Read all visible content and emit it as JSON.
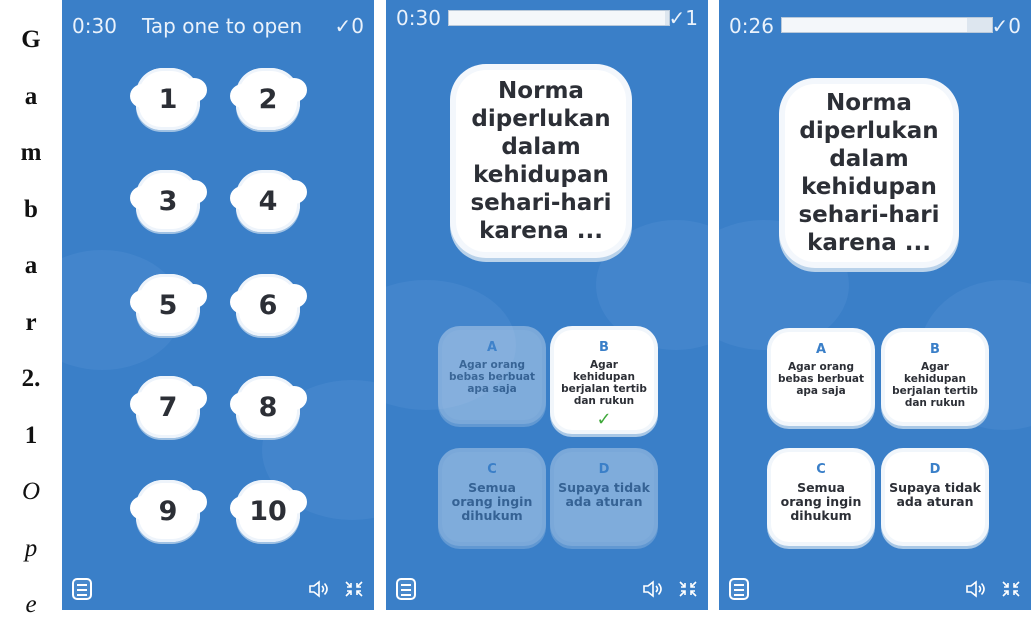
{
  "side_caption": [
    "G",
    "a",
    "m",
    "b",
    "a",
    "r",
    "2.",
    "1",
    "O",
    "p",
    "e"
  ],
  "panel1": {
    "timer": "0:30",
    "caption": "Tap one to open",
    "score": "✓0",
    "tiles": [
      "1",
      "2",
      "3",
      "4",
      "5",
      "6",
      "7",
      "8",
      "9",
      "10"
    ]
  },
  "panel2": {
    "timer": "0:30",
    "score": "✓1",
    "progress": 0.98,
    "question": [
      "Norma",
      "diperlukan",
      "dalam",
      "kehidupan",
      "sehari-hari",
      "karena ..."
    ],
    "answers": [
      {
        "letter": "A",
        "text": "Agar orang bebas berbuat apa saja"
      },
      {
        "letter": "B",
        "text": "Agar kehidupan berjalan tertib dan rukun",
        "mark": "✓"
      },
      {
        "letter": "C",
        "text": "Semua orang ingin dihukum"
      },
      {
        "letter": "D",
        "text": "Supaya tidak ada aturan"
      }
    ]
  },
  "panel3": {
    "timer": "0:26",
    "score": "✓0",
    "progress": 0.88,
    "question": [
      "Norma",
      "diperlukan",
      "dalam",
      "kehidupan",
      "sehari-hari",
      "karena ..."
    ],
    "answers": [
      {
        "letter": "A",
        "text": "Agar orang bebas berbuat apa saja"
      },
      {
        "letter": "B",
        "text": "Agar kehidupan berjalan tertib dan rukun"
      },
      {
        "letter": "C",
        "text": "Semua orang ingin dihukum"
      },
      {
        "letter": "D",
        "text": "Supaya tidak ada aturan"
      }
    ]
  },
  "icons": {
    "menu": "menu-icon",
    "sound": "speaker-icon",
    "fullscreen": "collapse-icon"
  },
  "colors": {
    "background": "#3a7fc8",
    "check": "#3fa83a",
    "letter": "#3a7fc8"
  }
}
